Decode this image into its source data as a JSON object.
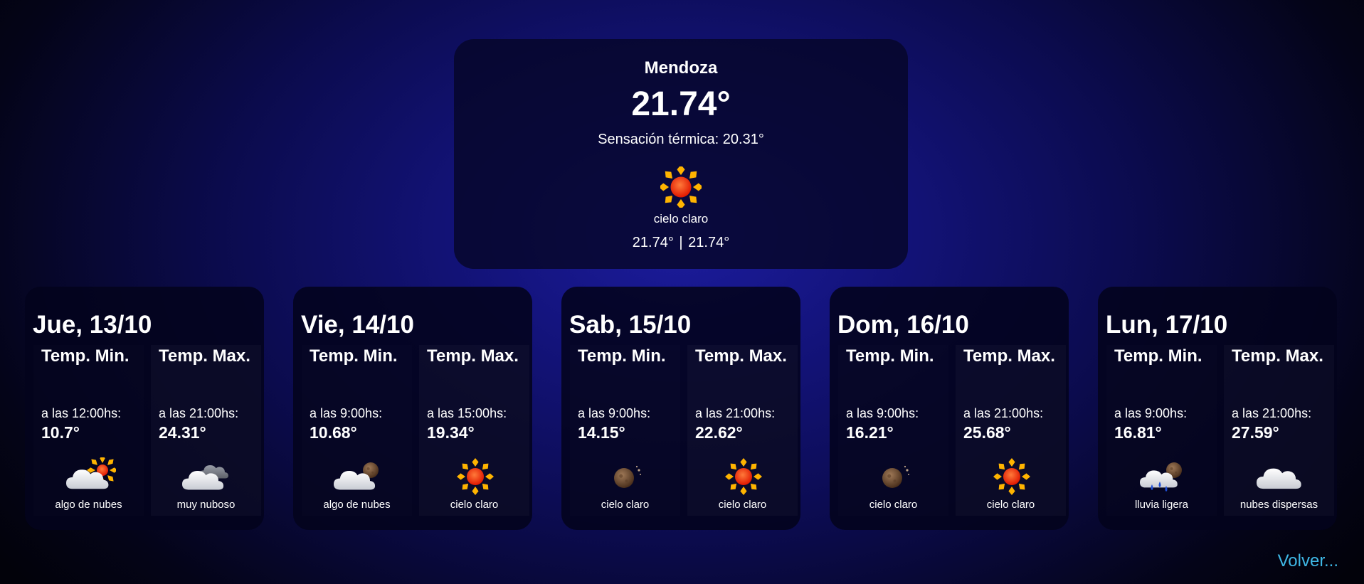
{
  "current": {
    "city": "Mendoza",
    "temp": "21.74°",
    "feels_like": "Sensación térmica: 20.31°",
    "icon": "sun-icon",
    "description": "cielo claro",
    "min": "21.74°",
    "separator": "|",
    "max": "21.74°"
  },
  "days": [
    {
      "title": "Jue, 13/10",
      "min_label": "Temp. Min.",
      "min_time": "a las 12:00hs:",
      "min_value": "10.7°",
      "min_icon": "cloud-sun-icon",
      "min_desc": "algo de nubes",
      "max_label": "Temp. Max.",
      "max_time": "a las 21:00hs:",
      "max_value": "24.31°",
      "max_icon": "cloudy-icon",
      "max_desc": "muy nuboso"
    },
    {
      "title": "Vie, 14/10",
      "min_label": "Temp. Min.",
      "min_time": "a las 9:00hs:",
      "min_value": "10.68°",
      "min_icon": "cloud-moon-icon",
      "min_desc": "algo de nubes",
      "max_label": "Temp. Max.",
      "max_time": "a las 15:00hs:",
      "max_value": "19.34°",
      "max_icon": "sun-icon",
      "max_desc": "cielo claro"
    },
    {
      "title": "Sab, 15/10",
      "min_label": "Temp. Min.",
      "min_time": "a las 9:00hs:",
      "min_value": "14.15°",
      "min_icon": "moon-icon",
      "min_desc": "cielo claro",
      "max_label": "Temp. Max.",
      "max_time": "a las 21:00hs:",
      "max_value": "22.62°",
      "max_icon": "sun-icon",
      "max_desc": "cielo claro"
    },
    {
      "title": "Dom, 16/10",
      "min_label": "Temp. Min.",
      "min_time": "a las 9:00hs:",
      "min_value": "16.21°",
      "min_icon": "moon-icon",
      "min_desc": "cielo claro",
      "max_label": "Temp. Max.",
      "max_time": "a las 21:00hs:",
      "max_value": "25.68°",
      "max_icon": "sun-icon",
      "max_desc": "cielo claro"
    },
    {
      "title": "Lun, 17/10",
      "min_label": "Temp. Min.",
      "min_time": "a las 9:00hs:",
      "min_value": "16.81°",
      "min_icon": "rain-moon-icon",
      "min_desc": "lluvia ligera",
      "max_label": "Temp. Max.",
      "max_time": "a las 21:00hs:",
      "max_value": "27.59°",
      "max_icon": "cloud-icon",
      "max_desc": "nubes dispersas"
    }
  ],
  "back_link": "Volver...",
  "colors": {
    "link": "#3fb8e6",
    "sun": "#ff3b12",
    "sun_rays": "#ffb400"
  }
}
